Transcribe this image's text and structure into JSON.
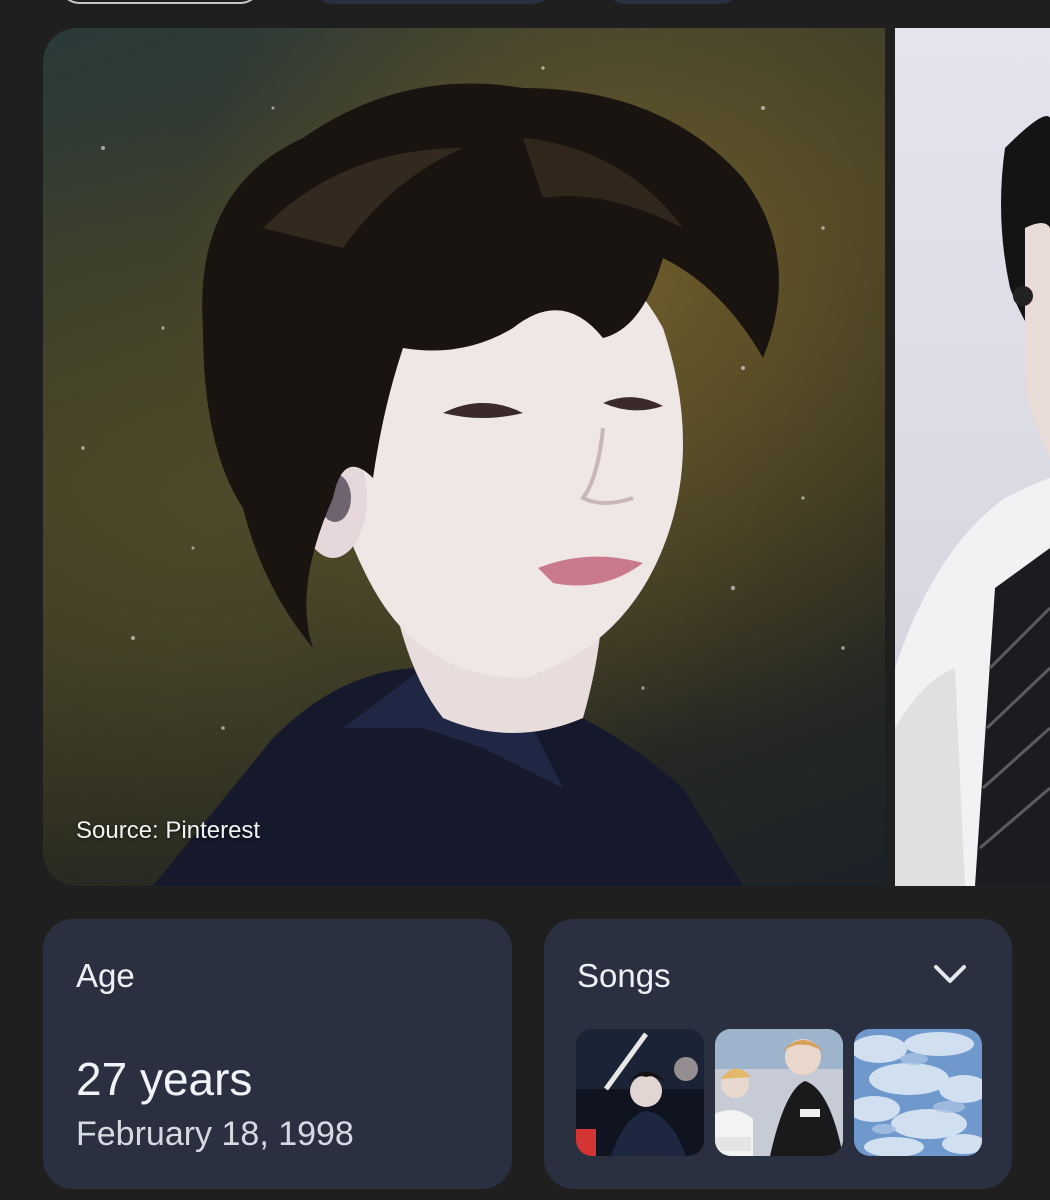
{
  "chips": [
    {
      "state": "selected"
    },
    {
      "state": "default"
    },
    {
      "state": "default"
    }
  ],
  "carousel": {
    "main_image": {
      "icon": "photo-portrait",
      "source_caption": "Source: Pinterest"
    },
    "next_image": {
      "icon": "photo-portrait"
    }
  },
  "age_card": {
    "title": "Age",
    "value": "27 years",
    "birth_date": "February 18, 1998"
  },
  "songs_card": {
    "title": "Songs",
    "expand_icon": "chevron-down-icon",
    "thumbnails": [
      {
        "icon": "song-thumbnail"
      },
      {
        "icon": "song-thumbnail"
      },
      {
        "icon": "song-thumbnail"
      }
    ]
  },
  "colors": {
    "page_background": "#1f1f1f",
    "card_background": "#2b3040",
    "text_primary": "#eef0f6",
    "text_secondary": "#d7dae3"
  }
}
